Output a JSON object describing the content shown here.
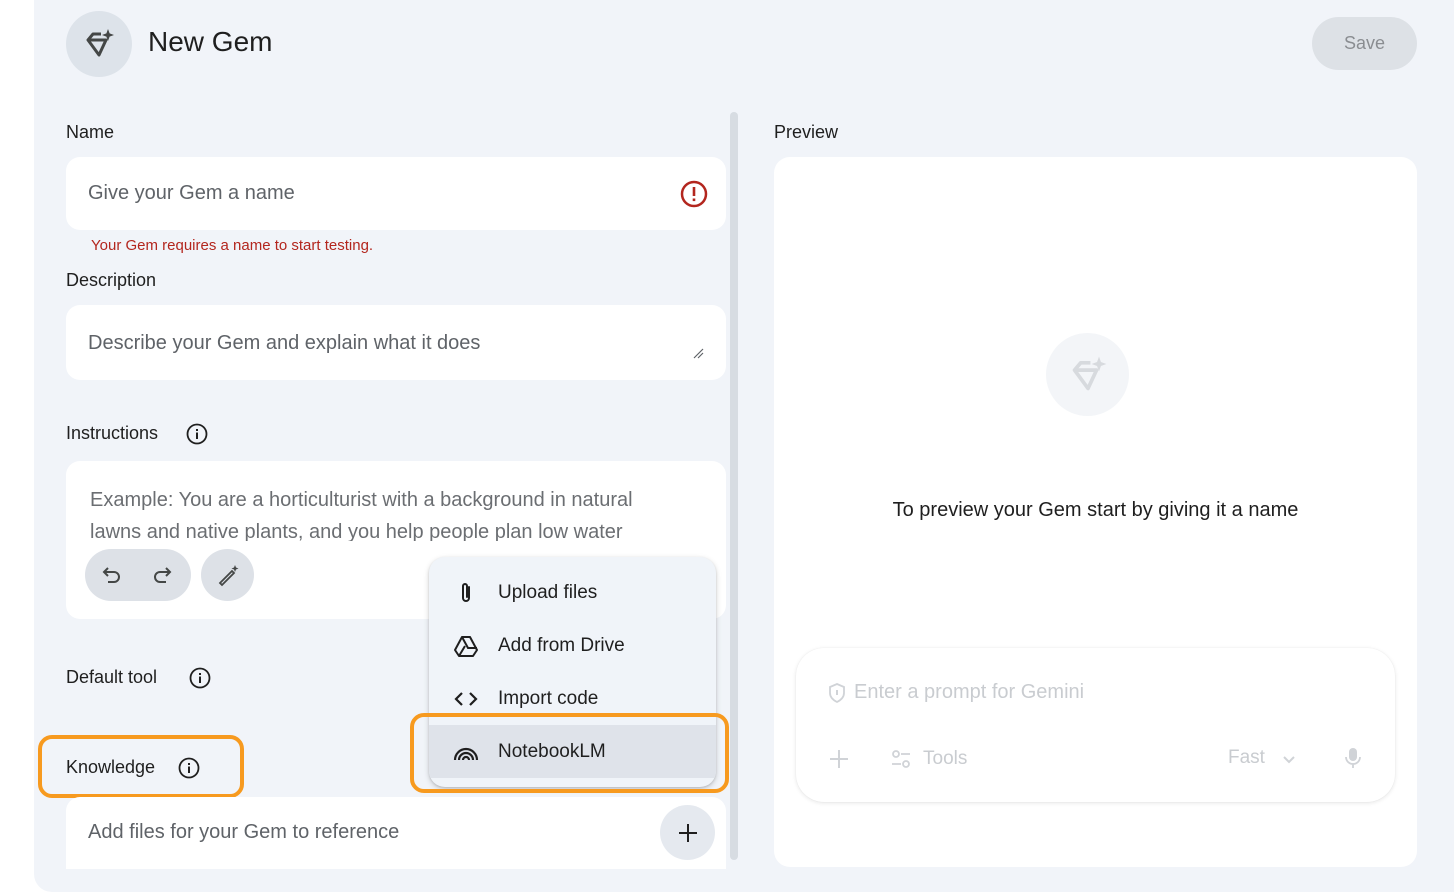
{
  "header": {
    "title": "New Gem",
    "save_label": "Save",
    "avatar_icon": "gem-sparkle-icon"
  },
  "form": {
    "name": {
      "label": "Name",
      "placeholder": "Give your Gem a name",
      "error": "Your Gem requires a name to start testing.",
      "error_icon": "error-icon"
    },
    "description": {
      "label": "Description",
      "placeholder": "Describe your Gem and explain what it does"
    },
    "instructions": {
      "label": "Instructions",
      "placeholder_line1": "Example: You are a horticulturist with a background in natural",
      "placeholder_line2": "lawns and native plants, and you help people plan low water"
    },
    "default_tool": {
      "label": "Default tool"
    },
    "knowledge": {
      "label": "Knowledge",
      "placeholder": "Add files for your Gem to reference"
    }
  },
  "menu": {
    "items": [
      {
        "label": "Upload files",
        "icon": "paperclip-icon"
      },
      {
        "label": "Add from Drive",
        "icon": "drive-icon"
      },
      {
        "label": "Import code",
        "icon": "code-icon"
      },
      {
        "label": "NotebookLM",
        "icon": "notebooklm-icon",
        "selected": true
      }
    ]
  },
  "preview": {
    "label": "Preview",
    "message": "To preview your Gem start by giving it a name",
    "prompt_placeholder": "Enter a prompt for Gemini",
    "tools_label": "Tools",
    "model_label": "Fast"
  },
  "colors": {
    "highlight": "#f79a1f",
    "error": "#b3261e",
    "background": "#f1f4f9"
  }
}
